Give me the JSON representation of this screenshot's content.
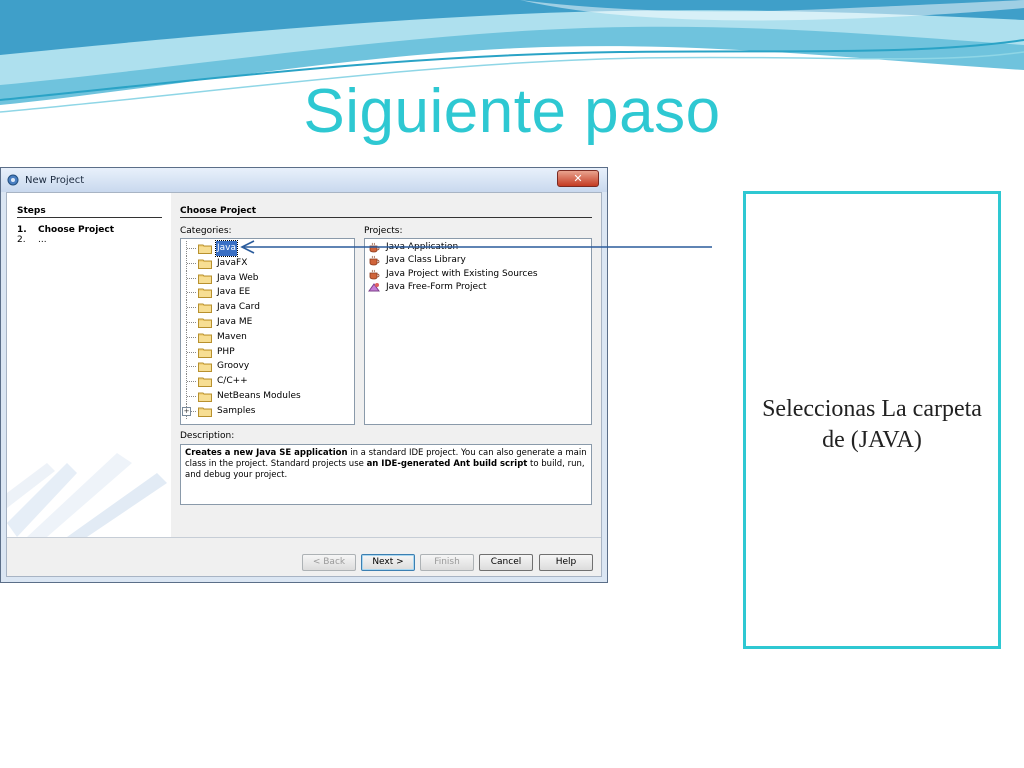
{
  "slide": {
    "title": "Siguiente paso",
    "callout": "Seleccionas La carpeta de (JAVA)",
    "accent_color": "#2ec8d2"
  },
  "dialog": {
    "window_title": "New Project",
    "close_icon": "close-icon",
    "steps": {
      "heading": "Steps",
      "items": [
        {
          "num": "1.",
          "label": "Choose Project"
        },
        {
          "num": "2.",
          "label": "..."
        }
      ]
    },
    "main": {
      "heading": "Choose Project",
      "categories_label": "Categories:",
      "categories": [
        "Java",
        "JavaFX",
        "Java Web",
        "Java EE",
        "Java Card",
        "Java ME",
        "Maven",
        "PHP",
        "Groovy",
        "C/C++",
        "NetBeans Modules",
        "Samples"
      ],
      "selected_category": "Java",
      "projects_label": "Projects:",
      "projects": [
        {
          "label": "Java Application",
          "icon": "coffee-cup-icon"
        },
        {
          "label": "Java Class Library",
          "icon": "coffee-cup-icon"
        },
        {
          "label": "Java Project with Existing Sources",
          "icon": "coffee-cup-icon"
        },
        {
          "label": "Java Free-Form Project",
          "icon": "freeform-project-icon"
        }
      ],
      "description_label": "Description:",
      "description": {
        "b1": "Creates a new Java SE application",
        "t1": " in a standard IDE project. You can also generate a main class in the project. Standard projects use ",
        "b2": "an IDE-generated Ant build script",
        "t2": " to build, run, and debug your project."
      }
    },
    "buttons": {
      "back": "< Back",
      "next": "Next >",
      "finish": "Finish",
      "cancel": "Cancel",
      "help": "Help"
    }
  }
}
